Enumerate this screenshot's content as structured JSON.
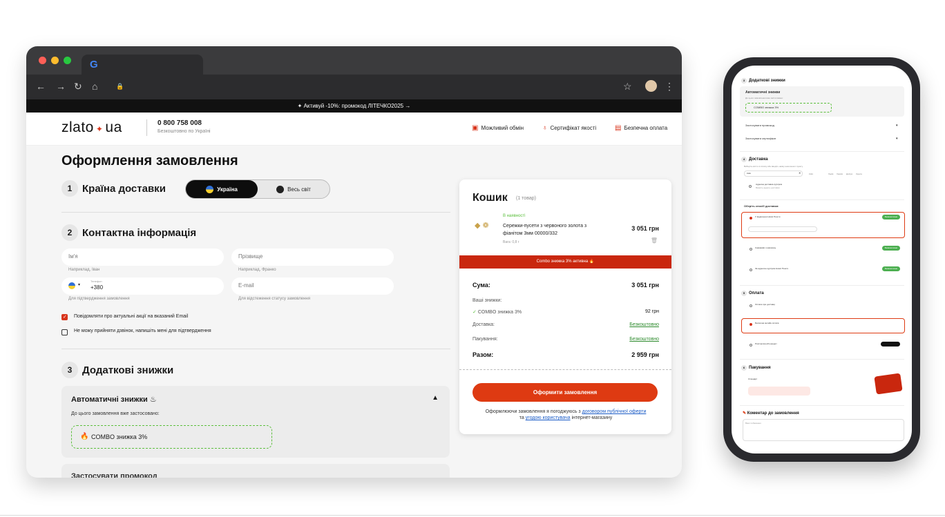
{
  "promo": "✦ Активуй -10%: промокод ЛІТЕЧКО2025 →",
  "site": {
    "logo_left": "zlato",
    "logo_dot": "✦",
    "logo_right": "ua",
    "phone": "0 800 758 008",
    "phone_sub": "Безкоштовно по Україні",
    "links": [
      "Можливий обмін",
      "Сертифікат якості",
      "Безпечна оплата"
    ]
  },
  "checkout": {
    "title": "Оформлення замовлення",
    "step1": {
      "num": "1",
      "label": "Країна доставки",
      "option_on": "Україна",
      "option_off": "Весь світ"
    },
    "step2": {
      "num": "2",
      "label": "Контактна інформація",
      "first_name": "Ім'я",
      "first_hint": "Наприклад, Іван",
      "last_name": "Прізвище",
      "last_hint": "Наприклад, Франко",
      "phone_label": "Телефон",
      "phone_code": "+380",
      "phone_hint": "Для підтвердження замовлення",
      "email": "E-mail",
      "email_hint": "Для відстеження статусу замовлення",
      "check1": "Повідомляти про актуальні акції на вказаний Email",
      "check2": "Не можу прийняти дзвінок, напишіть мені для підтвердження"
    },
    "step3": {
      "num": "3",
      "label": "Додаткові знижки",
      "auto_title": "Автоматичні знижки",
      "auto_sub": "До цього замовлення вже застосовано:",
      "combo": "COMBO знижка 3%",
      "promo_title": "Застосувати промокод"
    }
  },
  "cart": {
    "title": "Кошик",
    "count": "(1 товар)",
    "availability": "В наявності",
    "product_name": "Сережки-пусети з червоного золота з фіанітом 3мм 00000/332",
    "product_price": "3 051 грн",
    "weight": "Вага: 0,8 г",
    "banner": "Combo знижка 3% активна",
    "sum_label": "Сума:",
    "sum_value": "3 051 грн",
    "discounts_label": "Ваші знижки:",
    "combo_label": "COMBO знижка 3%",
    "combo_value": "92 грн",
    "delivery_label": "Доставка:",
    "delivery_value": "Безкоштовно",
    "packing_label": "Пакування:",
    "packing_value": "Безкоштовно",
    "total_label": "Разом:",
    "total_value": "2 959 грн",
    "order_button": "Оформити замовлення",
    "agree_text": "Оформлюючи замовлення я погоджуюсь з",
    "agree_link1": "договором публічної оферти",
    "agree_and": "та",
    "agree_link2": "угодою користувача",
    "agree_end": "інтернет-магазину"
  },
  "mobile": {
    "s3": "Додаткові знижки",
    "auto": "Автоматичні знижки",
    "auto_sub": "До цього замовлення вже застосовано:",
    "combo": "COMBO знижка 3%",
    "promo": "Застосувати промокод",
    "cert": "Застосувати сертифікат",
    "s4": "Доставка",
    "s4_sub": "Виберіть місто зі списку або введіть назву населеного пункту",
    "city": "Київ",
    "chips": [
      "Київ",
      "Львів",
      "Харків",
      "Дніпро",
      "Одеса"
    ],
    "addr_option": "Адресна доставка кур'єром",
    "addr_sub": "Вкажіть адресу доставки",
    "choose": "Оберіть спосіб доставки:",
    "opt1": "У відділення Нової Пошти",
    "opt2": "Самовивіз з магазину",
    "opt3": "За адресою кур'єром Нової Пошти",
    "free": "Безкоштовно",
    "s5": "Оплата",
    "pay1": "Оплата при доставці",
    "pay2": "Безпечна онлайн оплата",
    "pay3": "Розстрочка або кредит",
    "s6": "Пакування",
    "pack_title": "Стандарт",
    "comment": "Коментар до замовлення",
    "comment_ph": "Ваші побажання"
  }
}
